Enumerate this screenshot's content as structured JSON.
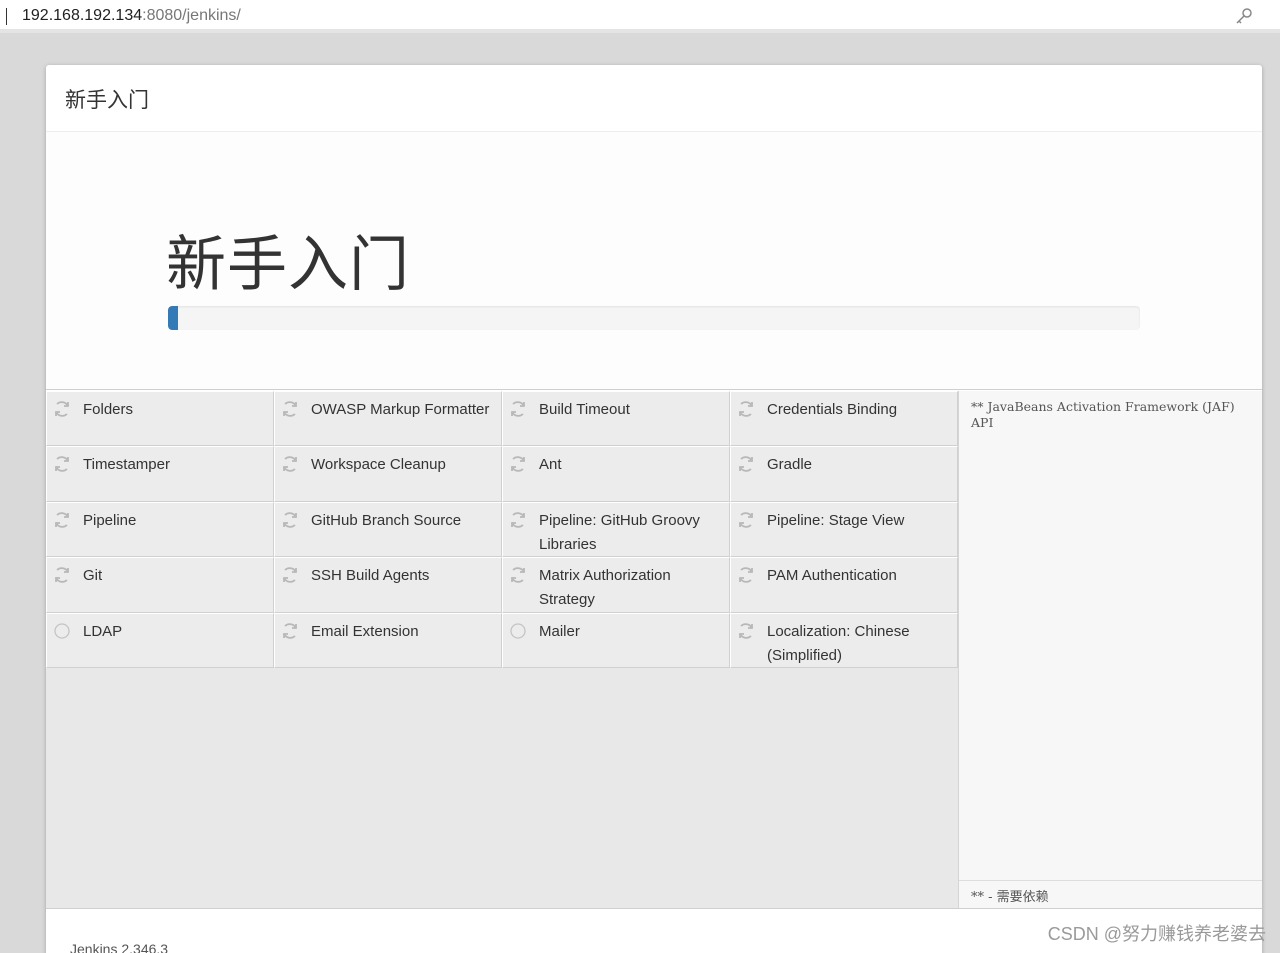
{
  "browser": {
    "url_host": "192.168.192.134",
    "url_path": ":8080/jenkins/",
    "key_icon": "key-icon"
  },
  "dialog": {
    "header_title": "新手入门",
    "hero_title": "新手入门",
    "progress_percent": 1
  },
  "plugins": [
    {
      "name": "Folders",
      "status": "installing",
      "icon": "refresh-icon"
    },
    {
      "name": "OWASP Markup Formatter",
      "status": "installing",
      "icon": "refresh-icon"
    },
    {
      "name": "Build Timeout",
      "status": "installing",
      "icon": "refresh-icon"
    },
    {
      "name": "Credentials Binding",
      "status": "installing",
      "icon": "refresh-icon"
    },
    {
      "name": "Timestamper",
      "status": "installing",
      "icon": "refresh-icon"
    },
    {
      "name": "Workspace Cleanup",
      "status": "installing",
      "icon": "refresh-icon"
    },
    {
      "name": "Ant",
      "status": "installing",
      "icon": "refresh-icon"
    },
    {
      "name": "Gradle",
      "status": "installing",
      "icon": "refresh-icon"
    },
    {
      "name": "Pipeline",
      "status": "installing",
      "icon": "refresh-icon"
    },
    {
      "name": "GitHub Branch Source",
      "status": "installing",
      "icon": "refresh-icon"
    },
    {
      "name": "Pipeline: GitHub Groovy Libraries",
      "status": "installing",
      "icon": "refresh-icon"
    },
    {
      "name": "Pipeline: Stage View",
      "status": "installing",
      "icon": "refresh-icon"
    },
    {
      "name": "Git",
      "status": "installing",
      "icon": "refresh-icon"
    },
    {
      "name": "SSH Build Agents",
      "status": "installing",
      "icon": "refresh-icon"
    },
    {
      "name": "Matrix Authorization Strategy",
      "status": "installing",
      "icon": "refresh-icon"
    },
    {
      "name": "PAM Authentication",
      "status": "installing",
      "icon": "refresh-icon"
    },
    {
      "name": "LDAP",
      "status": "pending",
      "icon": "circle-icon"
    },
    {
      "name": "Email Extension",
      "status": "installing",
      "icon": "refresh-icon"
    },
    {
      "name": "Mailer",
      "status": "pending",
      "icon": "circle-icon"
    },
    {
      "name": "Localization: Chinese (Simplified)",
      "status": "installing",
      "icon": "refresh-icon"
    }
  ],
  "log": {
    "text": "** JavaBeans Activation Framework (JAF) API",
    "footer": "** - 需要依赖"
  },
  "footer": {
    "version": "Jenkins 2.346.3"
  },
  "watermark": "CSDN @努力赚钱养老婆去",
  "colors": {
    "progress": "#337ab7",
    "grid_bg": "#ececec"
  }
}
